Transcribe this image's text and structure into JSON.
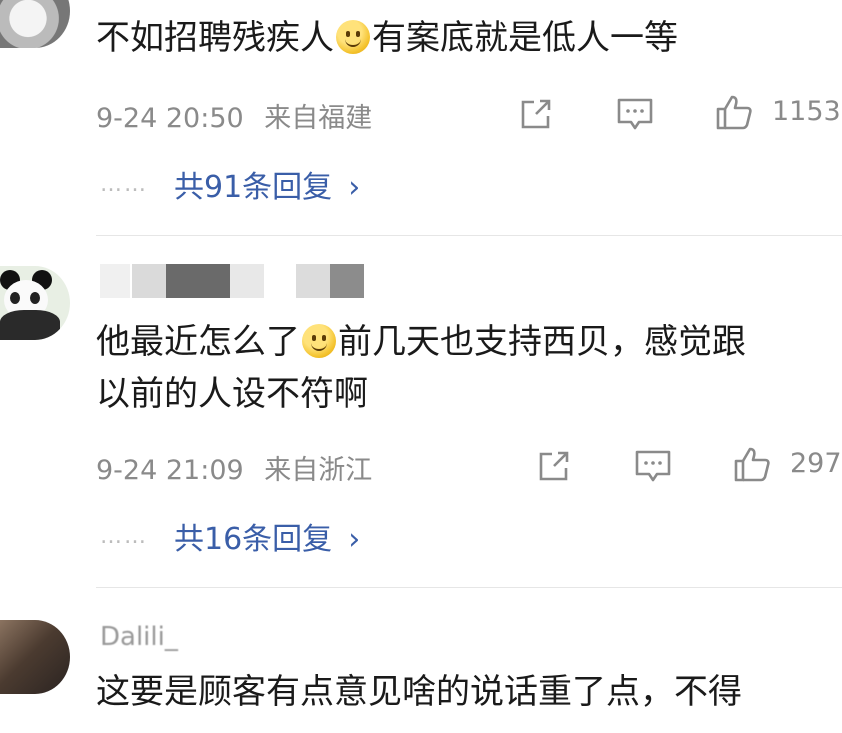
{
  "comments": [
    {
      "text_before": "不如招聘残疾人",
      "text_after": "有案底就是低人一等",
      "time": "9-24 20:50",
      "location": "来自福建",
      "likes": "1153",
      "replies": "共91条回复"
    },
    {
      "line1_before": "他最近怎么了",
      "line1_after": "前几天也支持西贝，感觉跟",
      "line2": "以前的人设不符啊",
      "time": "9-24 21:09",
      "location": "来自浙江",
      "likes": "297",
      "replies": "共16条回复"
    },
    {
      "username": "Dalili_",
      "line1": "这要是顾客有点意见啥的说话重了点，不得"
    }
  ],
  "icons": {
    "share": "share-icon",
    "comment": "comment-icon",
    "like": "thumbs-up-icon",
    "emoji": "smile-emoji-icon",
    "more": "chevron-right-icon"
  },
  "colors": {
    "link": "#3a5ea8",
    "meta": "#8a8a8a",
    "text": "#1a1a1a"
  },
  "dots": "……",
  "chevron": "›"
}
